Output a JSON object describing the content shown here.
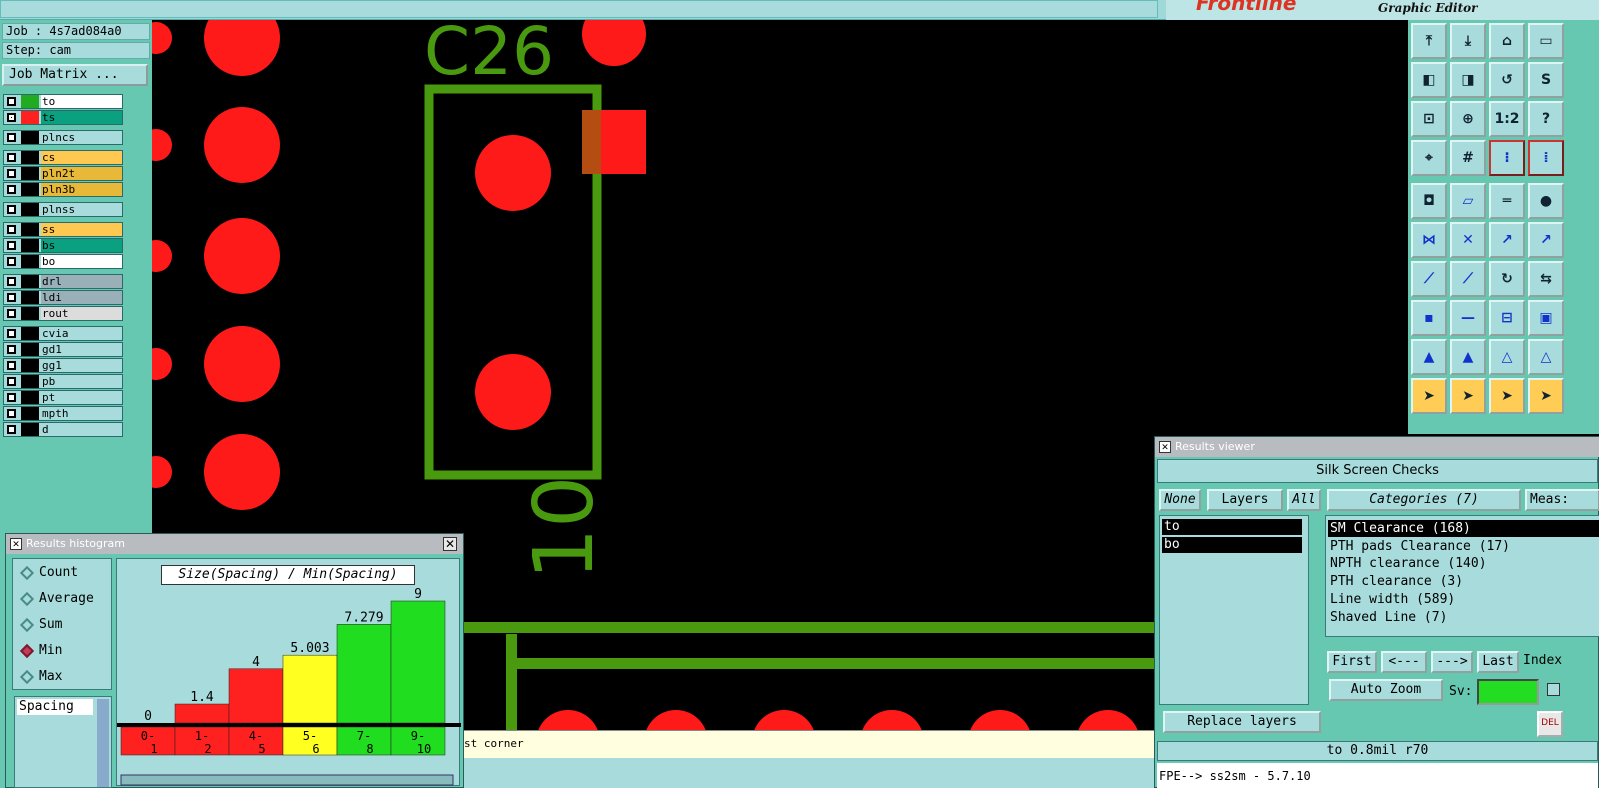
{
  "brand": {
    "logo": "Frontline",
    "subtitle": "Graphic Editor"
  },
  "job": {
    "job_label": "Job : 4s7ad084a0",
    "step_label": "Step: cam",
    "matrix_button": "Job Matrix ..."
  },
  "layers": [
    {
      "name": "to",
      "swatch": "#22aa22",
      "bg": "#ffffff",
      "checked": false
    },
    {
      "name": "ts",
      "swatch": "#ff2020",
      "bg": "#0aa080",
      "checked": true
    },
    {
      "name": "plncs",
      "swatch": "#000000",
      "bg": "#a8dcdc",
      "checked": false
    },
    {
      "name": "cs",
      "swatch": "#000000",
      "bg": "#ffc850",
      "checked": false
    },
    {
      "name": "pln2t",
      "swatch": "#000000",
      "bg": "#e8b838",
      "checked": false
    },
    {
      "name": "pln3b",
      "swatch": "#000000",
      "bg": "#e8b838",
      "checked": false
    },
    {
      "name": "plnss",
      "swatch": "#000000",
      "bg": "#a8dcdc",
      "checked": false
    },
    {
      "name": "ss",
      "swatch": "#000000",
      "bg": "#ffc850",
      "checked": false
    },
    {
      "name": "bs",
      "swatch": "#000000",
      "bg": "#0aa080",
      "checked": false
    },
    {
      "name": "bo",
      "swatch": "#000000",
      "bg": "#ffffff",
      "checked": false
    },
    {
      "name": "drl",
      "swatch": "#000000",
      "bg": "#9ab0b8",
      "checked": false
    },
    {
      "name": "ldi",
      "swatch": "#000000",
      "bg": "#9ab0b8",
      "checked": false
    },
    {
      "name": "rout",
      "swatch": "#000000",
      "bg": "#dcdcdc",
      "checked": false
    },
    {
      "name": "cvia",
      "swatch": "#000000",
      "bg": "#a8dcdc",
      "checked": false
    },
    {
      "name": "gd1",
      "swatch": "#000000",
      "bg": "#a8dcdc",
      "checked": false
    },
    {
      "name": "gg1",
      "swatch": "#000000",
      "bg": "#a8dcdc",
      "checked": false
    },
    {
      "name": "pb",
      "swatch": "#000000",
      "bg": "#a8dcdc",
      "checked": false
    },
    {
      "name": "pt",
      "swatch": "#000000",
      "bg": "#a8dcdc",
      "checked": false
    },
    {
      "name": "mpth",
      "swatch": "#000000",
      "bg": "#a8dcdc",
      "checked": false
    },
    {
      "name": "d",
      "swatch": "#000000",
      "bg": "#a8dcdc",
      "checked": false
    }
  ],
  "canvas": {
    "component_label": "C26",
    "pin_label": "10"
  },
  "toolbar_icons": [
    "zoom-home-icon",
    "zoom-pan-icon",
    "home-icon",
    "fit-screen-icon",
    "pan-left-icon",
    "pan-right-icon",
    "back-icon",
    "s-route-icon",
    "zoom-fit-icon",
    "zoom-in-icon",
    "ratio-icon",
    "help-icon",
    "snap-icon",
    "grid-icon",
    "net-icon",
    "net-alt-icon",
    "pad-icon",
    "outline-icon",
    "ruler-icon",
    "dot-icon",
    "connect-icon",
    "cross-icon",
    "point-icon",
    "point-alt-icon",
    "line-icon",
    "line-alt-icon",
    "rotate-icon",
    "mirror-icon",
    "pad-move-icon",
    "segment-icon",
    "measure-icon",
    "cluster-icon",
    "triangle-icon",
    "triangle-up-icon",
    "triangle-a-icon",
    "triangle-b-icon",
    "select-icon",
    "select-box-icon",
    "select-round-icon",
    "select-multi-icon"
  ],
  "histogram": {
    "title": "Results histogram",
    "modes": [
      "Count",
      "Average",
      "Sum",
      "Min",
      "Max"
    ],
    "selected_mode": "Min",
    "field": "Spacing",
    "chart_title": "Size(Spacing) / Min(Spacing)"
  },
  "chart_data": {
    "type": "bar",
    "title": "Size(Spacing) / Min(Spacing)",
    "categories": [
      "0-1",
      "1-2",
      "4-5",
      "5-6",
      "7-8",
      "9-10"
    ],
    "values": [
      0,
      1.4,
      4,
      5.003,
      7.279,
      9
    ],
    "value_labels": [
      "0",
      "1.4",
      "4",
      "5.003",
      "7.279",
      "9"
    ],
    "colors": [
      "#ff2020",
      "#ff2020",
      "#ff2020",
      "#ffff20",
      "#20dd20",
      "#20dd20"
    ],
    "ylim": [
      0,
      10
    ]
  },
  "status_text": "st corner",
  "viewer": {
    "title": "Results viewer",
    "check_name": "Silk Screen Checks",
    "none_btn": "None",
    "layers_btn": "Layers",
    "all_btn": "All",
    "categories_btn": "Categories (7)",
    "meas_btn": "Meas:",
    "layers": [
      "to",
      "bo"
    ],
    "categories": [
      "SM Clearance (168)",
      "PTH pads Clearance (17)",
      "NPTH clearance (140)",
      "PTH clearance (3)",
      "Line width (589)",
      "Shaved Line (7)"
    ],
    "selected_category": "SM Clearance (168)",
    "first_btn": "First",
    "prev_btn": "<---",
    "next_btn": "--->",
    "last_btn": "Last",
    "index_label": "Index",
    "autozoom_btn": "Auto Zoom",
    "sv_label": "Sv:",
    "replace_btn": "Replace layers",
    "status": "to 0.8mil  r70",
    "cmdline": "FPE--> ss2sm - 5.7.10",
    "del_label": "DEL"
  }
}
